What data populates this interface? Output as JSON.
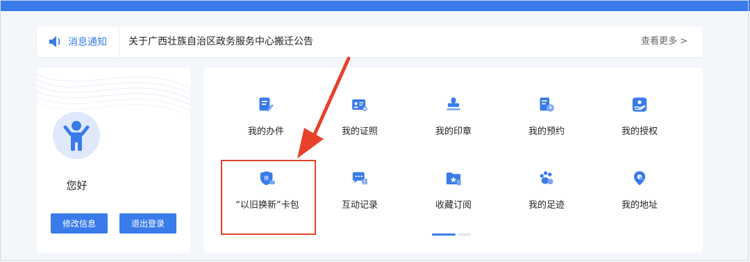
{
  "notice": {
    "tag_label": "消息通知",
    "text": "关于广西壮族自治区政务服务中心搬迁公告",
    "more_label": "查看更多 >"
  },
  "user": {
    "greeting": "您好",
    "edit_label": "修改信息",
    "logout_label": "退出登录"
  },
  "services": [
    {
      "label": "我的办件",
      "icon": "edit-document-icon"
    },
    {
      "label": "我的证照",
      "icon": "id-card-icon"
    },
    {
      "label": "我的印章",
      "icon": "stamp-icon"
    },
    {
      "label": "我的预约",
      "icon": "calendar-clock-icon"
    },
    {
      "label": "我的授权",
      "icon": "authorization-icon"
    },
    {
      "label": "“以旧换新”卡包",
      "icon": "exchange-shield-icon"
    },
    {
      "label": "互动记录",
      "icon": "chat-icon"
    },
    {
      "label": "收藏订阅",
      "icon": "folder-star-icon"
    },
    {
      "label": "我的足迹",
      "icon": "footprint-icon"
    },
    {
      "label": "我的地址",
      "icon": "location-pin-icon"
    }
  ],
  "colors": {
    "accent": "#3a7bea",
    "highlight": "#e8402a"
  }
}
